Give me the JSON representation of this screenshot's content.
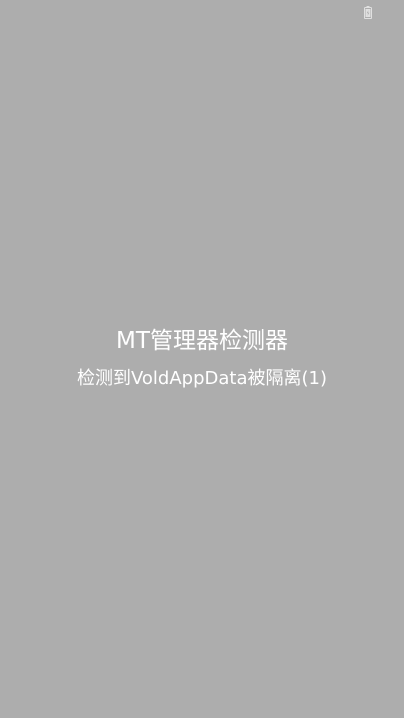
{
  "status_bar": {
    "battery_icon": "battery-icon"
  },
  "main": {
    "title": "MT管理器检测器",
    "message": "检测到VoldAppData被隔离(1)"
  },
  "colors": {
    "background": "#adadad",
    "text": "#ffffff",
    "icon": "#e0e0e0"
  }
}
